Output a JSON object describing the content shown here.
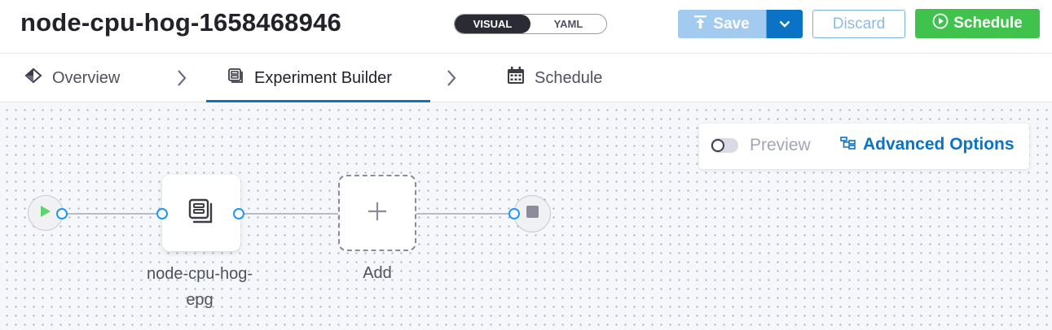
{
  "header": {
    "title": "node-cpu-hog-1658468946",
    "view_toggle": {
      "visual": "VISUAL",
      "yaml": "YAML",
      "selected": "VISUAL"
    },
    "save_label": "Save",
    "discard_label": "Discard",
    "schedule_label": "Schedule"
  },
  "tabs": [
    {
      "label": "Overview",
      "icon": "overview-icon",
      "active": false
    },
    {
      "label": "Experiment Builder",
      "icon": "experiment-builder-icon",
      "active": true
    },
    {
      "label": "Schedule",
      "icon": "calendar-icon",
      "active": false
    }
  ],
  "canvas": {
    "options_panel": {
      "preview_label": "Preview",
      "preview_enabled": false,
      "advanced_options_label": "Advanced Options"
    },
    "nodes": {
      "step_label_line1": "node-cpu-hog-",
      "step_label_line2": "epg",
      "add_label": "Add",
      "add_symbol": "+"
    }
  },
  "colors": {
    "primary": "#0b73c5",
    "save_disabled": "#a3cbef",
    "schedule_green": "#3fc34d",
    "port_blue": "#1b98f0",
    "start_play_green": "#5fd36b"
  }
}
